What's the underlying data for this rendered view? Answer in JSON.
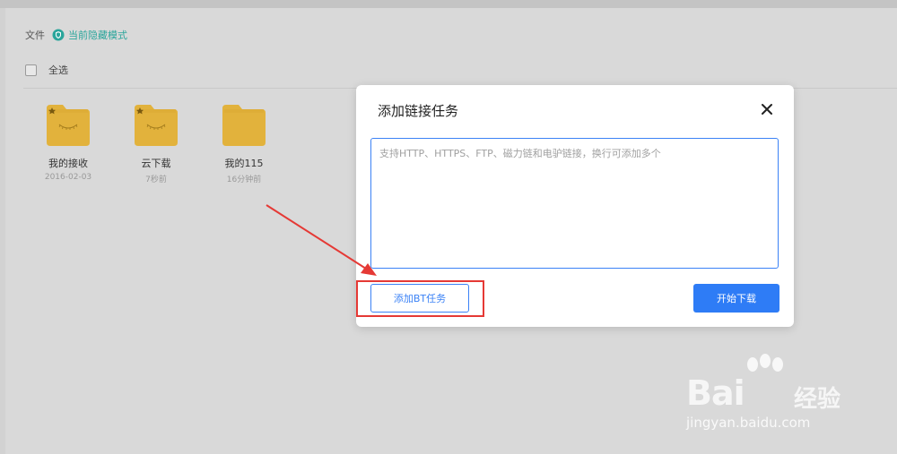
{
  "breadcrumb": {
    "root": "文件",
    "mode": "当前隐藏模式"
  },
  "select_all_label": "全选",
  "folders": [
    {
      "name": "我的接收",
      "date": "2016-02-03",
      "starred": true,
      "icon": "smile-folder-icon"
    },
    {
      "name": "云下载",
      "date": "7秒前",
      "starred": true,
      "icon": "smile-folder-icon"
    },
    {
      "name": "我的115",
      "date": "16分钟前",
      "starred": false,
      "icon": "folder-icon"
    }
  ],
  "dialog": {
    "title": "添加链接任务",
    "input_placeholder": "支持HTTP、HTTPS、FTP、磁力链和电驴链接，换行可添加多个",
    "input_value": "",
    "bt_button": "添加BT任务",
    "start_button": "开始下载"
  },
  "watermark": {
    "brand": "Bai",
    "cn": "经验",
    "url": "jingyan.baidu.com"
  },
  "colors": {
    "accent": "#2e7cf6",
    "teal": "#2aa59b",
    "folder": "#e2b23c",
    "annotation": "#e53935"
  }
}
